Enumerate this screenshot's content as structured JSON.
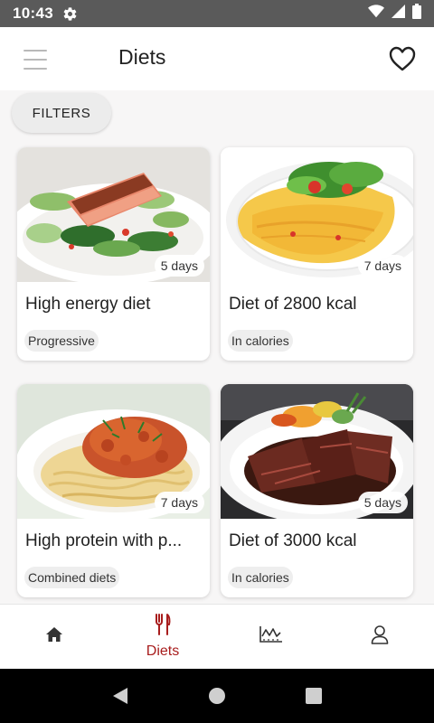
{
  "status_bar": {
    "time": "10:43"
  },
  "app_bar": {
    "title": "Diets"
  },
  "filters": {
    "label": "FILTERS"
  },
  "cards": [
    {
      "title": "High energy diet",
      "days": "5 days",
      "tag": "Progressive",
      "image": "salmon-zucchini-photo"
    },
    {
      "title": "Diet of 2800 kcal",
      "days": "7 days",
      "tag": "In calories",
      "image": "omelette-salad-photo"
    },
    {
      "title": "High protein with p...",
      "days": "7 days",
      "tag": "Combined diets",
      "image": "spaghetti-bolognese-photo"
    },
    {
      "title": "Diet of 3000 kcal",
      "days": "5 days",
      "tag": "In calories",
      "image": "steak-vegetables-photo"
    }
  ],
  "bottom_nav": {
    "items": [
      {
        "icon": "home-icon",
        "label": ""
      },
      {
        "icon": "fork-knife-icon",
        "label": "Diets",
        "active": true
      },
      {
        "icon": "chart-icon",
        "label": ""
      },
      {
        "icon": "profile-icon",
        "label": ""
      }
    ]
  },
  "colors": {
    "accent": "#a81d1d",
    "status_bar": "#5a5a5a",
    "background": "#f7f6f6"
  }
}
